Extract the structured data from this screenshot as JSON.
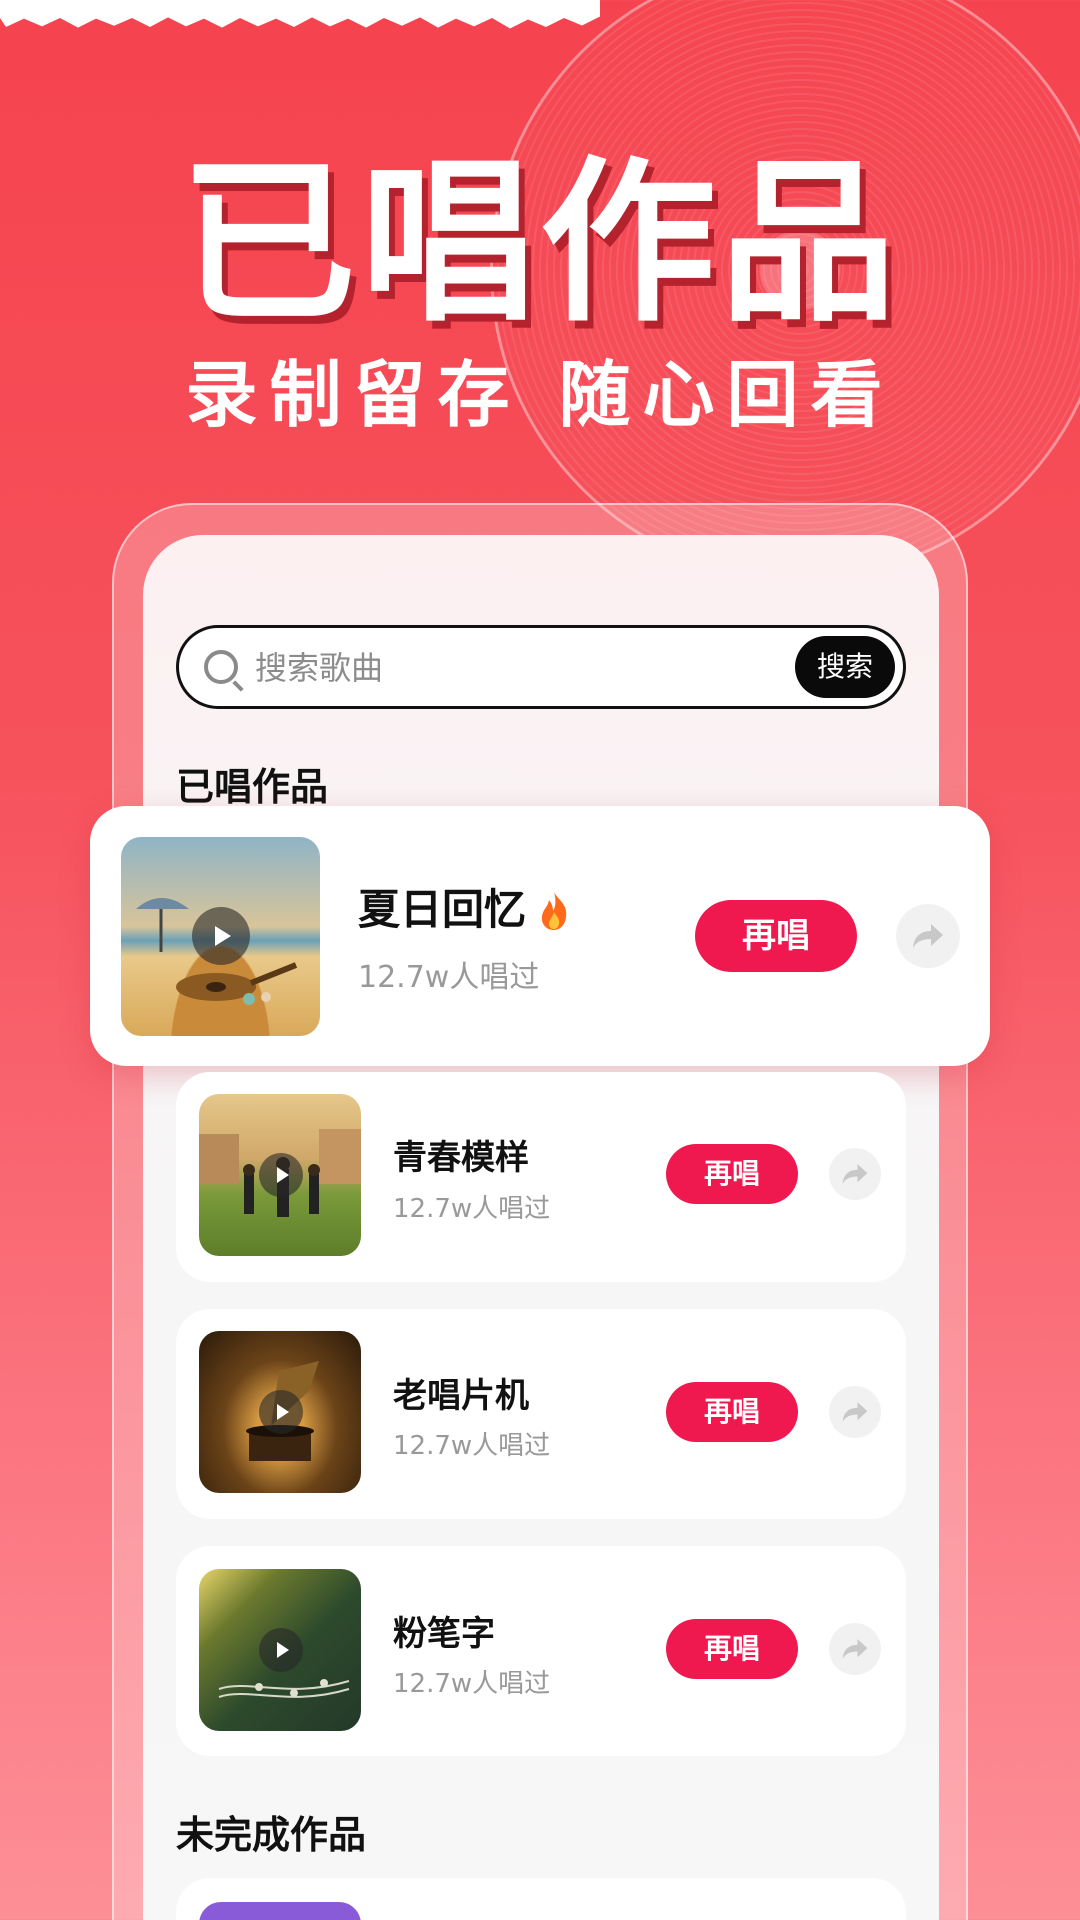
{
  "hero": {
    "title": "已唱作品",
    "subtitle": "录制留存 随心回看"
  },
  "search": {
    "placeholder": "搜索歌曲",
    "button_label": "搜索"
  },
  "sections": {
    "sung_title": "已唱作品",
    "unfinished_title": "未完成作品"
  },
  "songs": [
    {
      "title": "夏日回忆",
      "count": "12.7w人唱过",
      "action": "再唱",
      "hot": true,
      "thumb_icon": "beach-guitar-image"
    },
    {
      "title": "青春模样",
      "count": "12.7w人唱过",
      "action": "再唱",
      "hot": false,
      "thumb_icon": "students-running-image"
    },
    {
      "title": "老唱片机",
      "count": "12.7w人唱过",
      "action": "再唱",
      "hot": false,
      "thumb_icon": "phonograph-image"
    },
    {
      "title": "粉笔字",
      "count": "12.7w人唱过",
      "action": "再唱",
      "hot": false,
      "thumb_icon": "chalkboard-music-image"
    }
  ],
  "colors": {
    "accent": "#f0194f",
    "background_top": "#f5434f",
    "background_bottom": "#fd8f97"
  }
}
